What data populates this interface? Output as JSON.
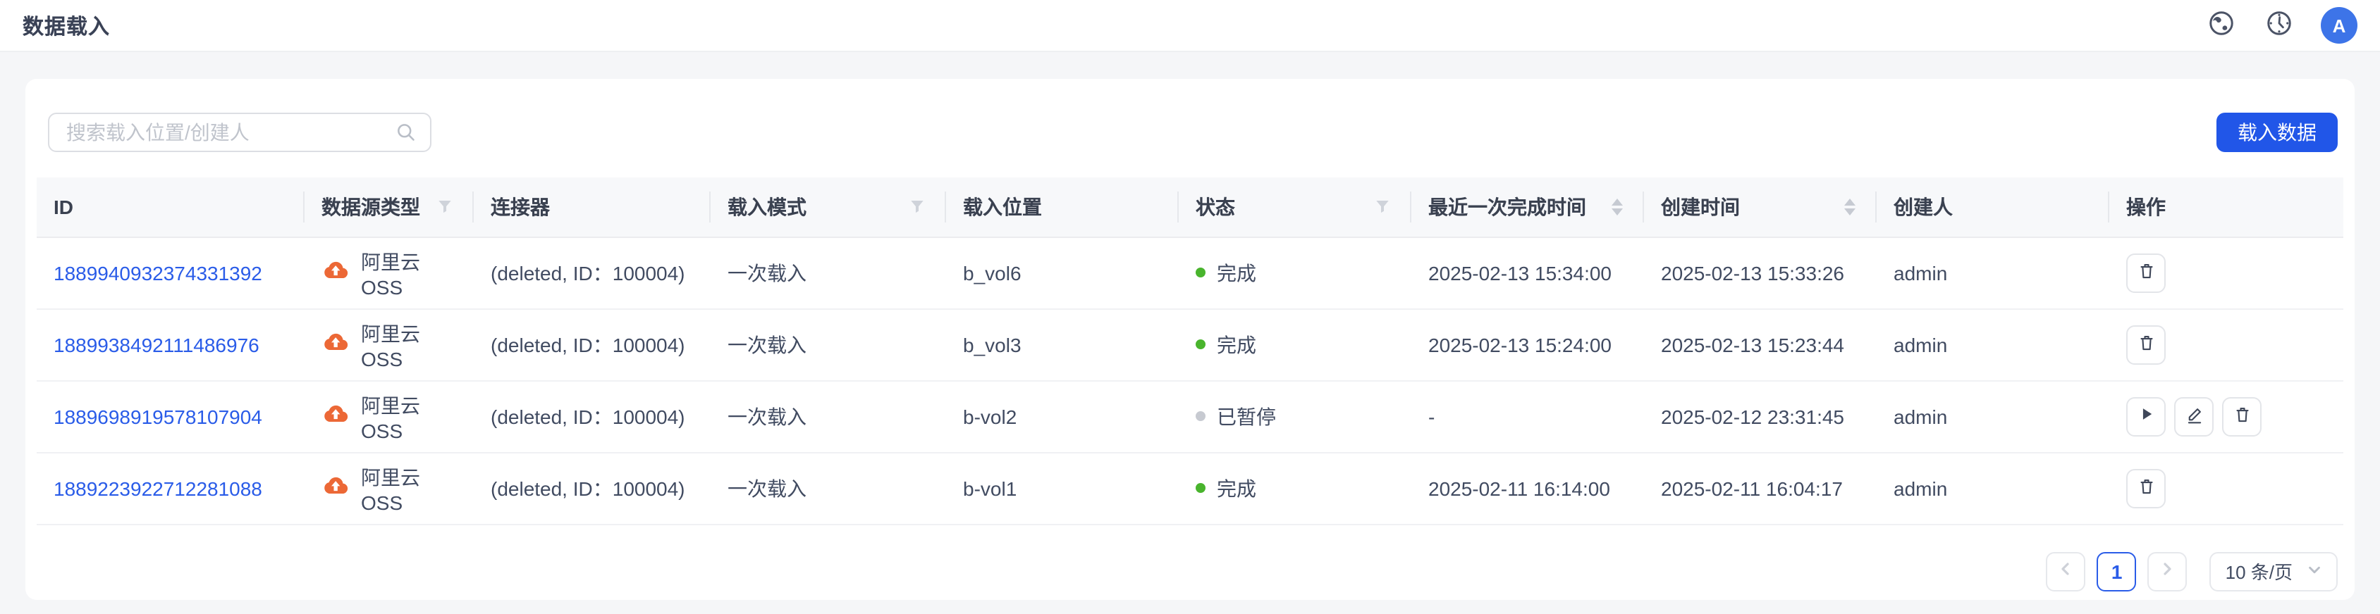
{
  "page": {
    "title": "数据载入"
  },
  "topbar": {
    "avatar": "A"
  },
  "toolbar": {
    "search_placeholder": "搜索载入位置/创建人",
    "load_button": "载入数据"
  },
  "table": {
    "columns": [
      {
        "label": "ID"
      },
      {
        "label": "数据源类型",
        "filter": true
      },
      {
        "label": "连接器"
      },
      {
        "label": "载入模式",
        "filter": true
      },
      {
        "label": "载入位置"
      },
      {
        "label": "状态",
        "filter": true
      },
      {
        "label": "最近一次完成时间",
        "sort": true
      },
      {
        "label": "创建时间",
        "sort": true
      },
      {
        "label": "创建人"
      },
      {
        "label": "操作"
      }
    ],
    "rows": [
      {
        "id": "1889940932374331392",
        "source_type": "阿里云 OSS",
        "connector": "(deleted, ID：100004)",
        "mode": "一次载入",
        "location": "b_vol6",
        "status": "完成",
        "status_type": "done",
        "last_finish_time": "2025-02-13 15:34:00",
        "create_time": "2025-02-13 15:33:26",
        "creator": "admin",
        "actions": [
          "delete"
        ]
      },
      {
        "id": "1889938492111486976",
        "source_type": "阿里云 OSS",
        "connector": "(deleted, ID：100004)",
        "mode": "一次载入",
        "location": "b_vol3",
        "status": "完成",
        "status_type": "done",
        "last_finish_time": "2025-02-13 15:24:00",
        "create_time": "2025-02-13 15:23:44",
        "creator": "admin",
        "actions": [
          "delete"
        ]
      },
      {
        "id": "1889698919578107904",
        "source_type": "阿里云 OSS",
        "connector": "(deleted, ID：100004)",
        "mode": "一次载入",
        "location": "b-vol2",
        "status": "已暂停",
        "status_type": "paused",
        "last_finish_time": "-",
        "create_time": "2025-02-12 23:31:45",
        "creator": "admin",
        "actions": [
          "play",
          "edit",
          "delete"
        ]
      },
      {
        "id": "1889223922712281088",
        "source_type": "阿里云 OSS",
        "connector": "(deleted, ID：100004)",
        "mode": "一次载入",
        "location": "b-vol1",
        "status": "完成",
        "status_type": "done",
        "last_finish_time": "2025-02-11 16:14:00",
        "create_time": "2025-02-11 16:04:17",
        "creator": "admin",
        "actions": [
          "delete"
        ]
      }
    ]
  },
  "pagination": {
    "current_page": "1",
    "page_size": "10 条/页"
  },
  "colors": {
    "accent_blue": "#2156e8",
    "link_blue": "#2a5ce8",
    "status_done_green": "#49b42d",
    "status_paused_gray": "#c7cad1",
    "oss_orange": "#ec6836",
    "avatar_blue": "#3d74e8"
  }
}
